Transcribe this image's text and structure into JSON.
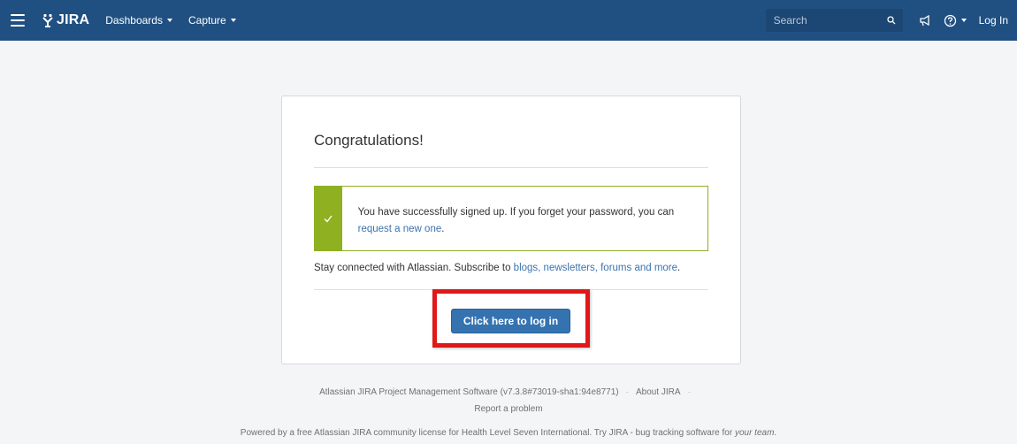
{
  "topbar": {
    "logo_text": "JIRA",
    "nav": [
      {
        "label": "Dashboards"
      },
      {
        "label": "Capture"
      }
    ],
    "search_placeholder": "Search",
    "login_label": "Log In"
  },
  "card": {
    "title": "Congratulations!",
    "success_message": "You have successfully signed up. If you forget your password, you can",
    "success_link": "request a new one",
    "success_suffix": ".",
    "stay_text": "Stay connected with Atlassian. Subscribe to",
    "stay_link": "blogs, newsletters, forums and more",
    "stay_suffix": ".",
    "button_label": "Click here to log in"
  },
  "footer": {
    "product": "Atlassian JIRA Project Management Software (v7.3.8#73019-sha1:94e8771)",
    "about": "About JIRA",
    "report": "Report a problem",
    "powered_prefix": "Powered by a free Atlassian JIRA community license for Health Level Seven International. Try JIRA - bug tracking software for",
    "powered_link": "your team",
    "powered_suffix": "."
  },
  "colors": {
    "header": "#205081",
    "success": "#8eb021",
    "button": "#3572b0",
    "highlight": "#e01818",
    "link": "#3b73af"
  },
  "icons": [
    "menu-icon",
    "jira-logo-icon",
    "search-icon",
    "feedback-megaphone-icon",
    "help-icon",
    "checkmark-icon"
  ]
}
